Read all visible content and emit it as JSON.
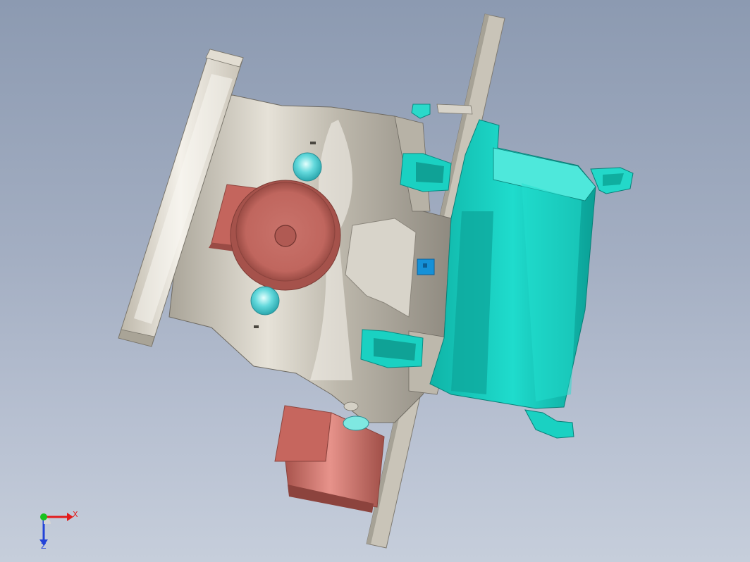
{
  "viewport": {
    "background_top": "#8c9ab1",
    "background_bottom": "#c6cedb"
  },
  "model": {
    "colors": {
      "metal": "#cfcabd",
      "metal_dark": "#8f8a80",
      "metal_light": "#ebe8df",
      "teal": "#16d3c4",
      "teal_dark": "#0b9f94",
      "teal_light": "#7ff0e6",
      "salmon": "#c96d64",
      "salmon_dark": "#9a4b45",
      "salmon_light": "#e08a82",
      "blue_tag": "#1591d8"
    }
  },
  "triad": {
    "x_label": "X",
    "z_label": "Z",
    "colors": {
      "x": "#e21b1b",
      "y": "#18c21e",
      "z": "#2343d8"
    }
  }
}
